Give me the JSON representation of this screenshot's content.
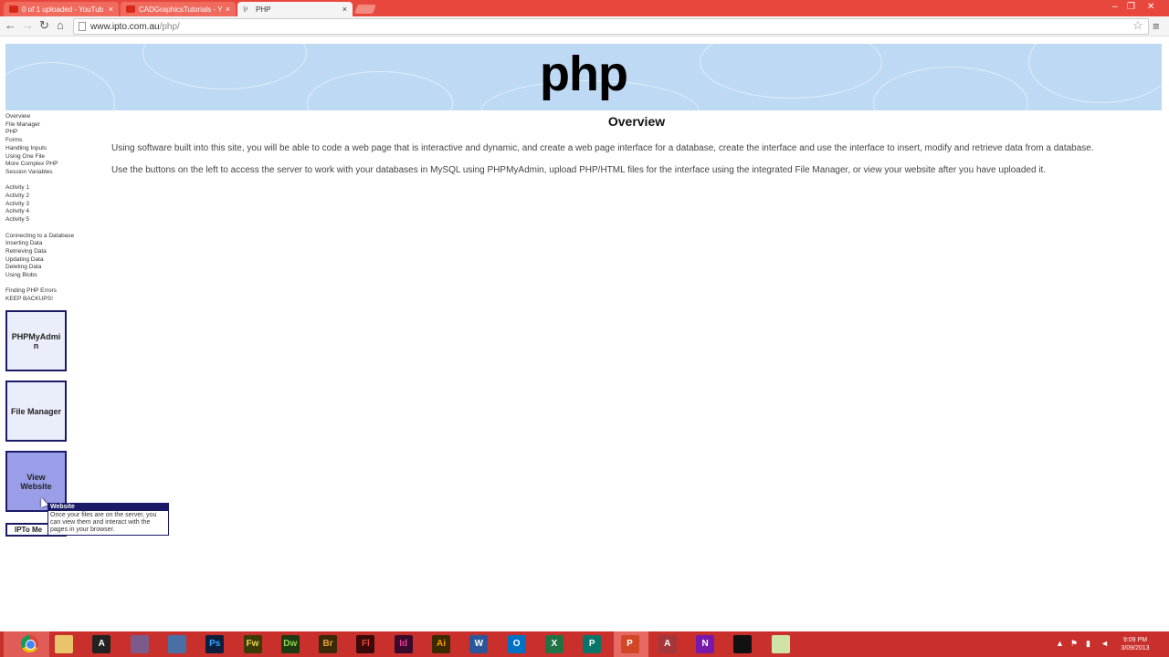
{
  "browser": {
    "tabs": [
      {
        "title": "0 of 1 uploaded - YouTub",
        "active": false
      },
      {
        "title": "CADGraphicsTutorials - Y",
        "active": false
      },
      {
        "title": "PHP",
        "active": true
      }
    ],
    "url_host": "www.ipto.com.au",
    "url_path": "/php/"
  },
  "page": {
    "banner_title": "php",
    "heading": "Overview",
    "paragraphs": [
      "Using software built into this site, you will be able to code a web page that is interactive and dynamic, and create a web page interface for a database, create the interface and use the interface to insert, modify and retrieve data from a database.",
      "Use the buttons on the left to access the server to work with your databases in MySQL using PHPMyAdmin, upload PHP/HTML files for the interface using the integrated File Manager, or view your website after you have uploaded it."
    ]
  },
  "sidebar": {
    "group1": [
      "Overview",
      "File Manager",
      "PHP",
      "Forms",
      "Handling Inputs",
      "Using One File",
      "More Complex PHP",
      "Session Variables"
    ],
    "group2": [
      "Activity 1",
      "Activity 2",
      "Activity 3",
      "Activity 4",
      "Activity 5"
    ],
    "group3": [
      "Connecting to a Database",
      "Inserting Data",
      "Retrieving Data",
      "Updating Data",
      "Deleting Data",
      "Using Blobs"
    ],
    "group4": [
      "Finding PHP Errors",
      "KEEP BACKUPS!"
    ],
    "buttons": {
      "phpmyadmin": "PHPMyAdmin",
      "file_manager": "File Manager",
      "view_website": "View Website",
      "ipto": "IPTo Me"
    }
  },
  "tooltip": {
    "title": "Website",
    "body": "Once your files are on the server, you can view them and interact with the pages in your browser."
  },
  "taskbar": {
    "apps": [
      {
        "name": "file-explorer",
        "label": "",
        "bg": "#e9c46a",
        "color": "#000"
      },
      {
        "name": "autocad",
        "label": "A",
        "bg": "#222222",
        "color": "#fff"
      },
      {
        "name": "3dsmax",
        "label": "",
        "bg": "#7c5a8a",
        "color": "#fff"
      },
      {
        "name": "image-app",
        "label": "",
        "bg": "#4a6fa5",
        "color": "#fff"
      },
      {
        "name": "photoshop",
        "label": "Ps",
        "bg": "#0d1f3c",
        "color": "#31a8ff"
      },
      {
        "name": "fireworks",
        "label": "Fw",
        "bg": "#3b3b0a",
        "color": "#e8d44d"
      },
      {
        "name": "dreamweaver",
        "label": "Dw",
        "bg": "#1e3a10",
        "color": "#8fd14f"
      },
      {
        "name": "bridge",
        "label": "Br",
        "bg": "#3a2a0a",
        "color": "#e8a23c"
      },
      {
        "name": "flash",
        "label": "Fl",
        "bg": "#3a0a0a",
        "color": "#e8453c"
      },
      {
        "name": "indesign",
        "label": "Id",
        "bg": "#3a0a2a",
        "color": "#e83c9a"
      },
      {
        "name": "illustrator",
        "label": "Ai",
        "bg": "#3a2a00",
        "color": "#ff9a00"
      },
      {
        "name": "word",
        "label": "W",
        "bg": "#2b579a",
        "color": "#fff"
      },
      {
        "name": "outlook",
        "label": "O",
        "bg": "#0072c6",
        "color": "#fff"
      },
      {
        "name": "excel",
        "label": "X",
        "bg": "#217346",
        "color": "#fff"
      },
      {
        "name": "publisher",
        "label": "P",
        "bg": "#077568",
        "color": "#fff"
      },
      {
        "name": "powerpoint",
        "label": "P",
        "bg": "#d24726",
        "color": "#fff"
      },
      {
        "name": "access",
        "label": "A",
        "bg": "#a4373a",
        "color": "#fff"
      },
      {
        "name": "onenote",
        "label": "N",
        "bg": "#7719aa",
        "color": "#fff"
      },
      {
        "name": "cmd",
        "label": "",
        "bg": "#111111",
        "color": "#fff"
      },
      {
        "name": "notes-app",
        "label": "",
        "bg": "#cfe3a8",
        "color": "#000"
      }
    ],
    "time": "9:09 PM",
    "date": "3/09/2013"
  },
  "colors": {
    "chrome_frame": "#e8473d",
    "banner": "#bdd9f3",
    "button_border": "#1a1a66",
    "button_hover": "#9a9ee8",
    "taskbar": "#c9302c"
  }
}
